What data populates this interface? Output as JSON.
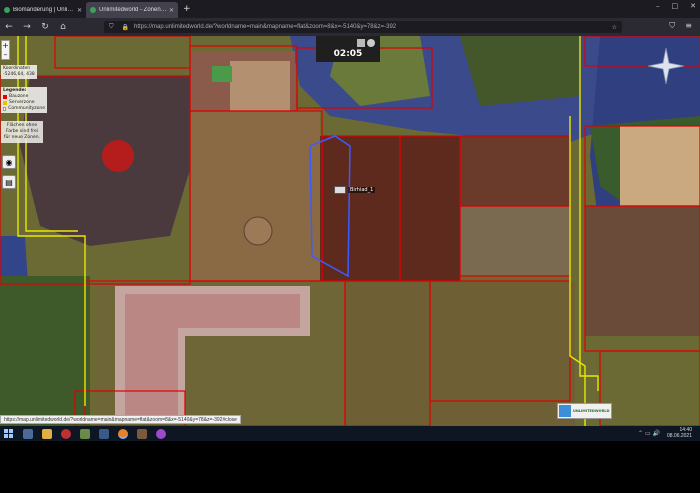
{
  "browser": {
    "tabs": [
      {
        "label": "Biomänderung | UnlimitedworldX",
        "active": false
      },
      {
        "label": "Unlimitedworld - Zonenkarte",
        "active": true
      }
    ],
    "url": "https://map.unlimitedworld.de/?worldname=main&mapname=flat&zoom=8&x=-5140&y=78&z=-392",
    "window_controls": [
      "–",
      "□",
      "✕"
    ]
  },
  "map": {
    "zoom_in": "+",
    "zoom_out": "–",
    "coords_title": "Koordinaten",
    "coords_value": "-5246,64, 438",
    "legend_title": "Legende:",
    "legend_items": [
      {
        "label": "Bauzone",
        "color": "#e00000"
      },
      {
        "label": "Serverzone",
        "color": "#e8c400"
      },
      {
        "label": "Communityzone",
        "color": "#ffffff"
      }
    ],
    "hint_text": "Flächen ohne Farbe sind frei für neue Zonen.",
    "clock": "02:05",
    "player_label": "Birhiad_1",
    "logo_text": "UNLIMITEDWORLD"
  },
  "status_bar_url": "https://map.unlimitedworld.de/?worldname=main&mapname=flat&zoom=8&x=-5140&y=78&z=-392#close",
  "taskbar": {
    "time": "14:40",
    "date": "08.06.2021"
  },
  "colors": {
    "zone_red": "#e00000",
    "zone_yellow": "#e8e800",
    "zone_blue": "#3c5cff"
  }
}
